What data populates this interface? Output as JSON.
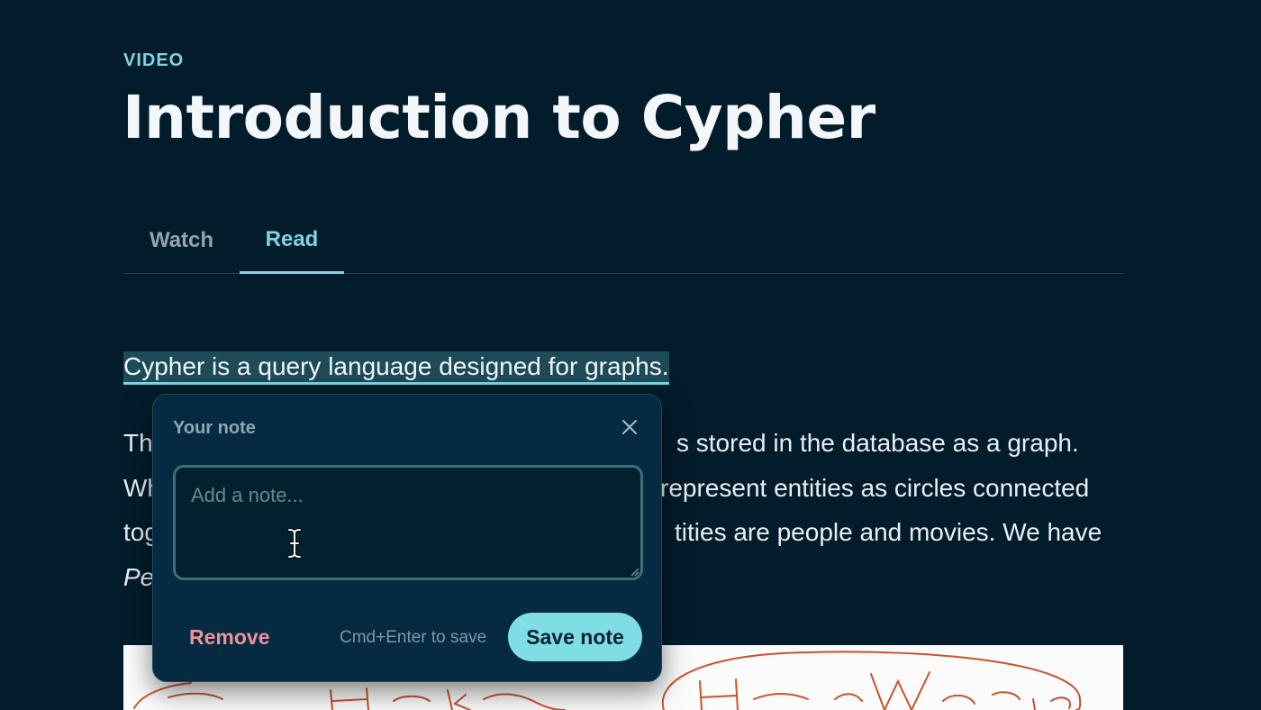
{
  "header": {
    "eyebrow": "VIDEO",
    "title": "Introduction to Cypher"
  },
  "tabs": [
    {
      "label": "Watch",
      "active": false
    },
    {
      "label": "Read",
      "active": true
    }
  ],
  "content": {
    "highlighted_sentence": "Cypher is a query language designed for graphs.",
    "paragraph_lines": [
      {
        "left": "Th",
        "right": "s stored in the database as a graph."
      },
      {
        "left": "Wh",
        "right": "represent entities as circles connected"
      },
      {
        "left": "tog",
        "right": "tities are people and movies. We have"
      },
      {
        "left": "Pe",
        "right": ""
      }
    ]
  },
  "note_popup": {
    "title": "Your note",
    "placeholder": "Add a note...",
    "value": "",
    "remove_label": "Remove",
    "hint": "Cmd+Enter to save",
    "save_label": "Save note"
  },
  "colors": {
    "background": "#021c2c",
    "accent": "#7fd3e2",
    "remove": "#f0929a",
    "save_button": "#7fdde6"
  },
  "icons": {
    "close": "close-icon",
    "cursor": "text-cursor-icon",
    "resize": "resize-grip-icon"
  }
}
